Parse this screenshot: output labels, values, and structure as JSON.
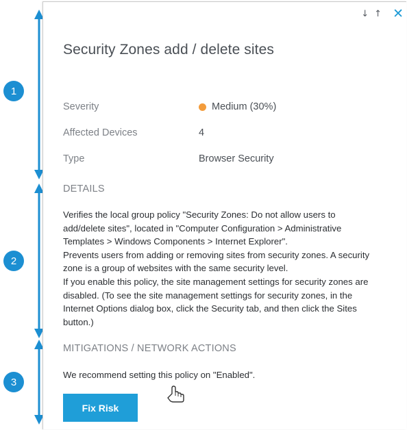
{
  "panel": {
    "sort_down": "↓",
    "sort_up": "↑",
    "close": "✕",
    "title": "Security Zones add / delete sites"
  },
  "info": {
    "rows": [
      {
        "label": "Severity",
        "value": "Medium (30%)",
        "dot_color": "#f39c3c"
      },
      {
        "label": "Affected Devices",
        "value": "4"
      },
      {
        "label": "Type",
        "value": "Browser Security"
      }
    ]
  },
  "details": {
    "heading": "DETAILS",
    "lines": [
      "Verifies the local group policy \"Security Zones: Do not allow users to",
      "add/delete sites\", located in \"Computer Configuration > Administrative",
      "Templates > Windows Components > Internet Explorer\".",
      "Prevents users from adding or removing sites from security zones. A security",
      "zone is a group of websites with the same security level.",
      "If you enable this policy, the site management settings for security zones are",
      "disabled. (To see the site management settings for security zones, in the",
      "Internet Options dialog box, click the Security tab, and then click the Sites",
      "button.)"
    ]
  },
  "mitigations": {
    "heading": "MITIGATIONS / NETWORK ACTIONS",
    "text": "We recommend setting this policy on \"Enabled\".",
    "button_label": "Fix Risk"
  },
  "annotations": {
    "badges": [
      "1",
      "2",
      "3"
    ],
    "accent_color": "#1c8fd2"
  },
  "icons": {
    "close": "close-icon",
    "sort_down": "arrow-down-icon",
    "sort_up": "arrow-up-icon",
    "cursor": "hand-pointer-icon",
    "severity": "severity-dot-icon"
  }
}
